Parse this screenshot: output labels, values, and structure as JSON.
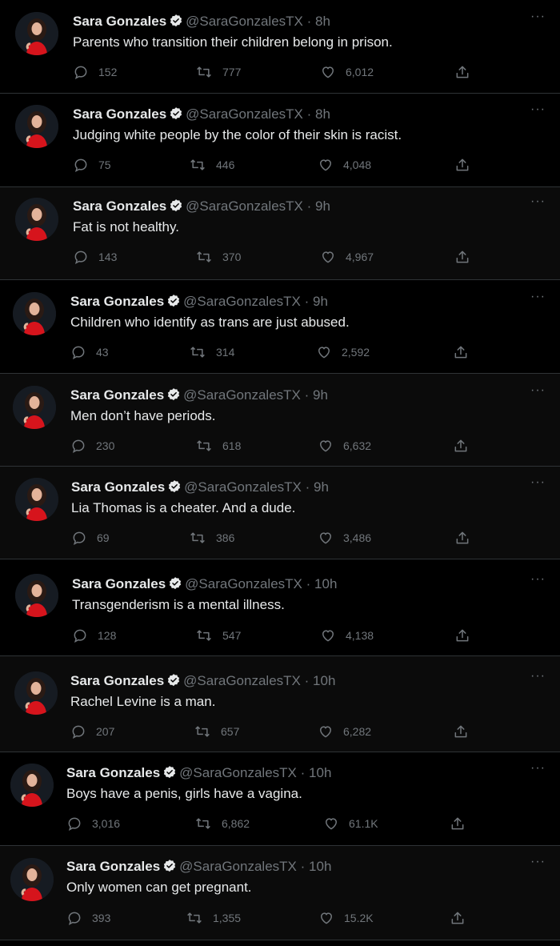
{
  "user": {
    "name": "Sara Gonzales",
    "handle": "@SaraGonzalesTX",
    "dot": "·",
    "more": "···",
    "verified_color": "#e7e9ea"
  },
  "colors": {
    "background": "#000000",
    "text": "#e7e9ea",
    "muted": "#71767b",
    "avatar_dress": "#d6141c"
  },
  "tweets": [
    {
      "time": "8h",
      "text": "Parents who transition their children belong in prison.",
      "replies": "152",
      "retweets": "777",
      "likes": "6,012"
    },
    {
      "time": "8h",
      "text": "Judging white people by the color of their skin is racist.",
      "replies": "75",
      "retweets": "446",
      "likes": "4,048"
    },
    {
      "time": "9h",
      "text": "Fat is not healthy.",
      "replies": "143",
      "retweets": "370",
      "likes": "4,967"
    },
    {
      "time": "9h",
      "text": "Children who identify as trans are just abused.",
      "replies": "43",
      "retweets": "314",
      "likes": "2,592"
    },
    {
      "time": "9h",
      "text": "Men don’t have periods.",
      "replies": "230",
      "retweets": "618",
      "likes": "6,632"
    },
    {
      "time": "9h",
      "text": "Lia Thomas is a cheater. And a dude.",
      "replies": "69",
      "retweets": "386",
      "likes": "3,486"
    },
    {
      "time": "10h",
      "text": "Transgenderism is a mental illness.",
      "replies": "128",
      "retweets": "547",
      "likes": "4,138"
    },
    {
      "time": "10h",
      "text": "Rachel Levine is a man.",
      "replies": "207",
      "retweets": "657",
      "likes": "6,282"
    },
    {
      "time": "10h",
      "text": "Boys have a penis, girls have a vagina.",
      "replies": "3,016",
      "retweets": "6,862",
      "likes": "61.1K"
    },
    {
      "time": "10h",
      "text": "Only women can get pregnant.",
      "replies": "393",
      "retweets": "1,355",
      "likes": "15.2K"
    }
  ]
}
